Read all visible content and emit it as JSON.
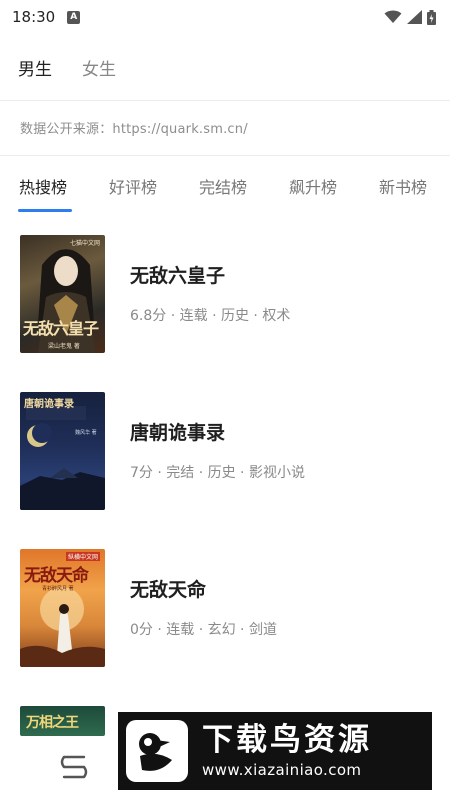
{
  "status_bar": {
    "time": "18:30",
    "notification_letter": "A"
  },
  "gender_tabs": [
    {
      "label": "男生",
      "active": true
    },
    {
      "label": "女生",
      "active": false
    }
  ],
  "source_note": "数据公开来源：https://quark.sm.cn/",
  "rank_tabs": [
    {
      "label": "热搜榜",
      "active": true
    },
    {
      "label": "好评榜",
      "active": false
    },
    {
      "label": "完结榜",
      "active": false
    },
    {
      "label": "飙升榜",
      "active": false
    },
    {
      "label": "新书榜",
      "active": false
    }
  ],
  "books": [
    {
      "title": "无敌六皇子",
      "meta": "6.8分 · 连载 · 历史 · 权术",
      "cover_text": "无敌六皇子",
      "cover_publisher": "七猫中文网",
      "cover_author": "梁山老鬼 著"
    },
    {
      "title": "唐朝诡事录",
      "meta": "7分 · 完结 · 历史 · 影视小说",
      "cover_text": "唐朝诡事录",
      "cover_author": "魏风华 著"
    },
    {
      "title": "无敌天命",
      "meta": "0分 · 连载 · 玄幻 · 剑道",
      "cover_text": "无敌天命",
      "cover_publisher": "纵横中文网",
      "cover_author": "青衫醉风月 著"
    },
    {
      "title": "",
      "meta": "",
      "cover_text": "万相之王"
    }
  ],
  "watermark": {
    "title": "下载鸟资源",
    "url": "www.xiazainiao.com"
  },
  "colors": {
    "accent": "#2d7cf0",
    "text_primary": "#1f1f1f",
    "text_secondary": "#8a8a8a"
  }
}
